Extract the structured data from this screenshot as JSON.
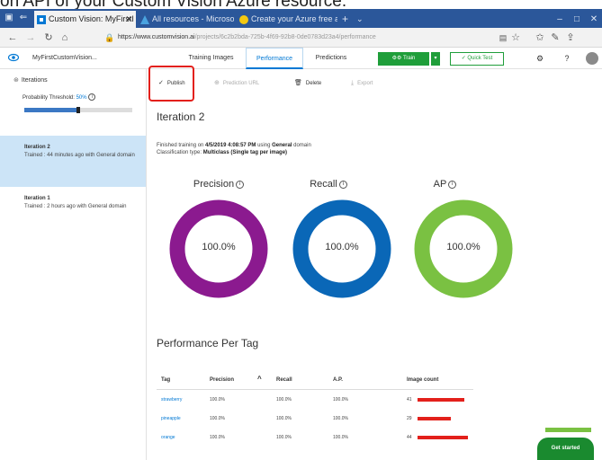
{
  "caption": "on API of your Custom Vision Azure resource.",
  "browser": {
    "tabs": [
      {
        "label": "Custom Vision: MyFirstI",
        "active": true
      },
      {
        "label": "All resources - Microsoft Az",
        "active": false
      },
      {
        "label": "Create your Azure free acco",
        "active": false
      }
    ],
    "url_host": "https://www.customvision.ai",
    "url_path": "/projects/6c2b2bda-725b-4f69-92b8-0de0783d23a4/performance"
  },
  "app": {
    "project_name": "MyFirstCustomVision...",
    "nav_tabs": [
      {
        "label": "Training Images",
        "selected": false
      },
      {
        "label": "Performance",
        "selected": true
      },
      {
        "label": "Predictions",
        "selected": false
      }
    ],
    "train_label": "Train",
    "quick_test_label": "Quick Test"
  },
  "sidebar": {
    "iterations_label": "Iterations",
    "probability_label": "Probability Threshold:",
    "probability_value": "50%",
    "slider_fraction": 0.5,
    "iterations": [
      {
        "name": "Iteration 2",
        "detail": "Trained : 44 minutes ago with General domain",
        "selected": true
      },
      {
        "name": "Iteration 1",
        "detail": "Trained : 2 hours ago with General domain",
        "selected": false
      }
    ]
  },
  "toolbar": {
    "publish": "Publish",
    "prediction_url": "Prediction URL",
    "delete": "Delete",
    "export": "Export"
  },
  "iteration": {
    "title": "Iteration 2",
    "finished_prefix": "Finished training on ",
    "finished_date": "4/5/2019 4:08:57 PM",
    "finished_mid": " using ",
    "finished_domain": "General",
    "finished_suffix": " domain",
    "class_prefix": "Classification type: ",
    "class_type": "Multiclass (Single tag per image)"
  },
  "metrics": [
    {
      "label": "Precision",
      "value": "100.0%",
      "color": "#8b1a8f"
    },
    {
      "label": "Recall",
      "value": "100.0%",
      "color": "#0a67b7"
    },
    {
      "label": "AP",
      "value": "100.0%",
      "color": "#7ac142"
    }
  ],
  "per_tag": {
    "title": "Performance Per Tag",
    "headers": [
      "Tag",
      "Precision",
      "Recall",
      "A.P.",
      "Image count"
    ],
    "rows": [
      {
        "tag": "strawberry",
        "precision": "100.0%",
        "recall": "100.0%",
        "ap": "100.0%",
        "count": "41",
        "count_value": 41
      },
      {
        "tag": "pineapple",
        "precision": "100.0%",
        "recall": "100.0%",
        "ap": "100.0%",
        "count": "29",
        "count_value": 29
      },
      {
        "tag": "orange",
        "precision": "100.0%",
        "recall": "100.0%",
        "ap": "100.0%",
        "count": "44",
        "count_value": 44
      }
    ],
    "max_count": 44
  },
  "get_started": "Get started"
}
